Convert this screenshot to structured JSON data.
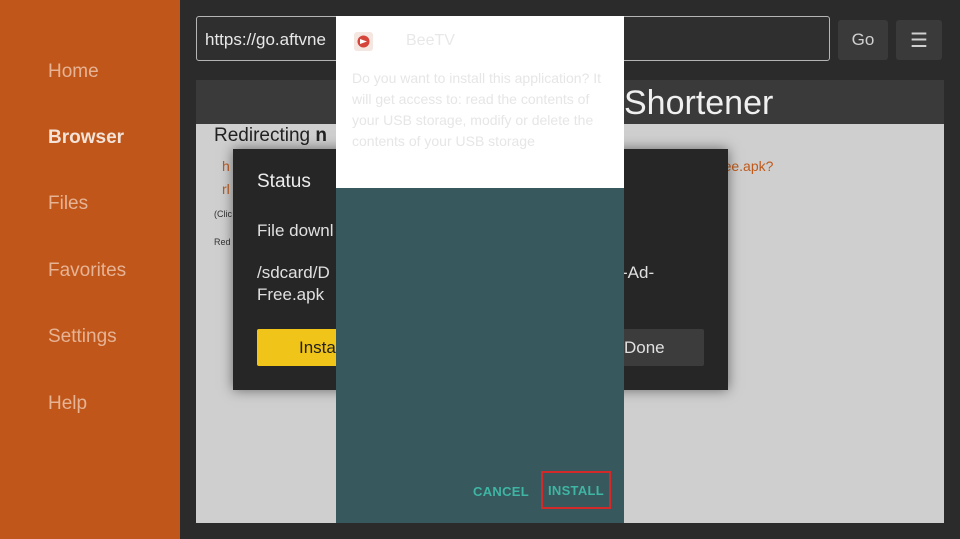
{
  "sidebar": {
    "items": [
      {
        "label": "Home"
      },
      {
        "label": "Browser"
      },
      {
        "label": "Files"
      },
      {
        "label": "Favorites"
      },
      {
        "label": "Settings"
      },
      {
        "label": "Help"
      }
    ],
    "active": "Browser"
  },
  "browser": {
    "url": "https://go.aftvne",
    "go_label": "Go",
    "menu_glyph": "☰"
  },
  "webpage": {
    "header_title": "Shortener",
    "redirecting_prefix": "Redirecting ",
    "redirecting_bold": "n",
    "link_right": "TV-v4.0.8-Ad-Free.apk?",
    "link_left_1": "h",
    "link_left_2": "rl",
    "small_1": "(Clic",
    "small_2": "Red"
  },
  "status_dialog": {
    "title": "Status",
    "download_text": "File downl",
    "path_line_1": "/sdcard/D",
    "path_line_1_right": "-Ad-",
    "path_line_2": "Free.apk",
    "install_label": "Insta",
    "done_label": "Done"
  },
  "installer": {
    "app_name": "BeeTV",
    "permission_text": "Do you want to install this application? It will get access to: read the contents of your USB storage, modify or delete the contents of your USB storage",
    "cancel_label": "CANCEL",
    "install_label": "INSTALL"
  },
  "colors": {
    "sidebar_bg": "#c0561a",
    "installer_bg": "#37585c",
    "teal_accent": "#3fb5a3",
    "highlight_border": "#d22a2a",
    "install_yellow": "#f0c419"
  }
}
